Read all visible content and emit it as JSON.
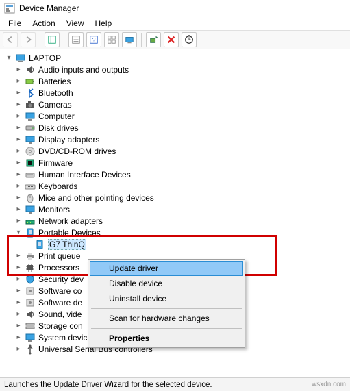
{
  "title": "Device Manager",
  "menu": {
    "file": "File",
    "action": "Action",
    "view": "View",
    "help": "Help"
  },
  "root": "LAPTOP",
  "nodes": {
    "n0": "Audio inputs and outputs",
    "n1": "Batteries",
    "n2": "Bluetooth",
    "n3": "Cameras",
    "n4": "Computer",
    "n5": "Disk drives",
    "n6": "Display adapters",
    "n7": "DVD/CD-ROM drives",
    "n8": "Firmware",
    "n9": "Human Interface Devices",
    "n10": "Keyboards",
    "n11": "Mice and other pointing devices",
    "n12": "Monitors",
    "n13": "Network adapters",
    "n14": "Portable Devices",
    "n15": "G7 ThinQ",
    "n16": "Print queue",
    "n17": "Processors",
    "n18": "Security dev",
    "n19": "Software co",
    "n20": "Software de",
    "n21": "Sound, vide",
    "n22": "Storage con",
    "n23": "System devices",
    "n24": "Universal Serial Bus controllers"
  },
  "context_menu": {
    "update": "Update driver",
    "disable": "Disable device",
    "uninstall": "Uninstall device",
    "scan": "Scan for hardware changes",
    "properties": "Properties"
  },
  "status": "Launches the Update Driver Wizard for the selected device.",
  "watermark": "wsxdn.com"
}
